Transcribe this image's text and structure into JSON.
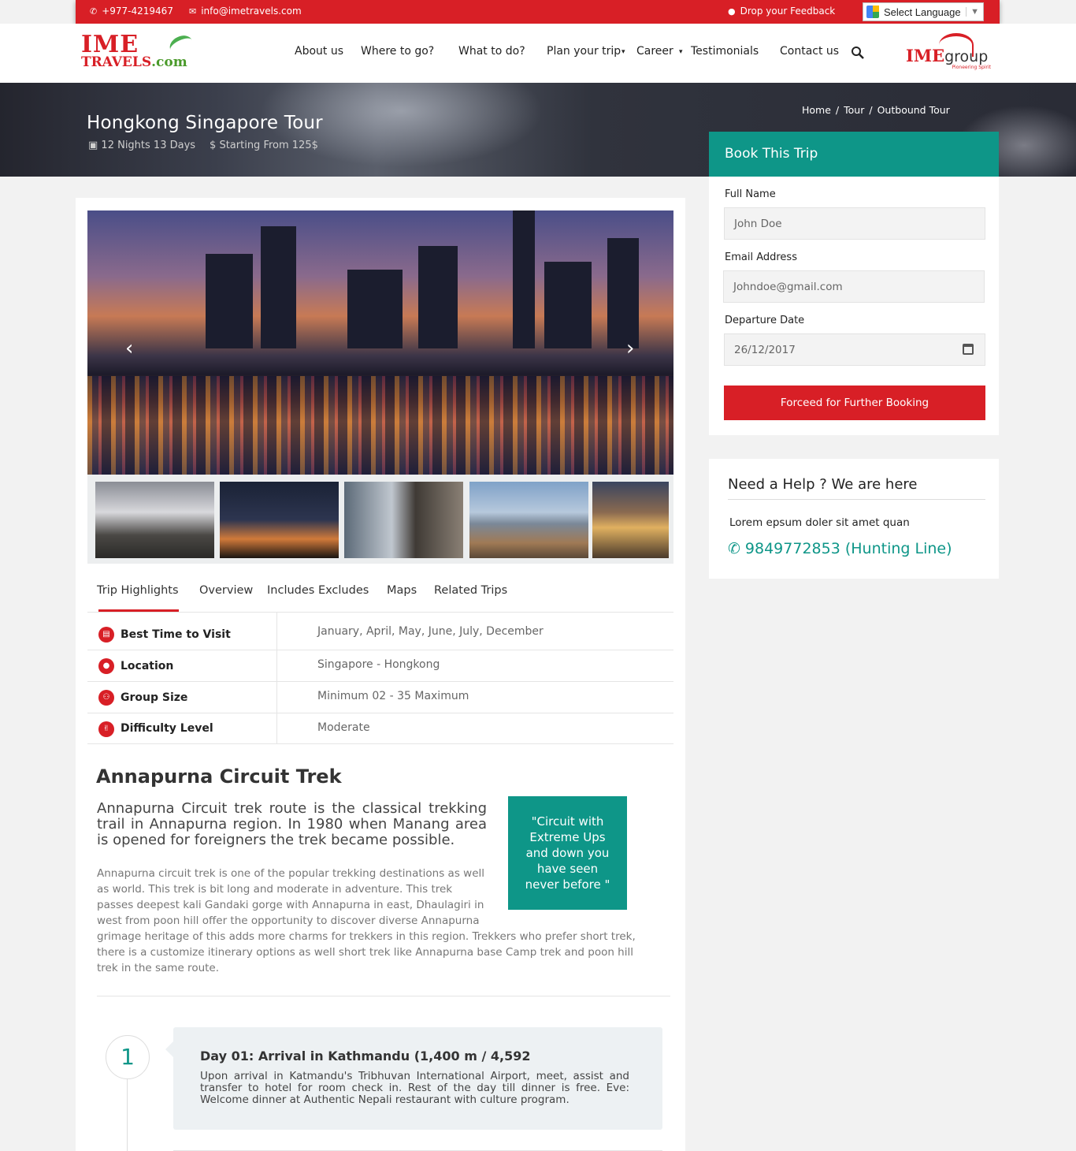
{
  "topbar": {
    "phone": "+977-4219467",
    "email": "info@imetravels.com",
    "feedback": "Drop your Feedback",
    "language": "Select Language"
  },
  "nav": {
    "logo_line1": "IME",
    "logo_line2a": "TRAVELS",
    "logo_line2b": ".com",
    "items": [
      "About us",
      "Where to go?",
      "What to do?",
      "Plan your trip",
      "Career",
      "Testimonials",
      "Contact us"
    ],
    "group_logo_a": "IME",
    "group_logo_b": "group",
    "group_tagline": "Pioneering Spirit"
  },
  "banner": {
    "title": "Hongkong Singapore Tour",
    "duration": "12 Nights 13 Days",
    "price": "$ Starting From 125$",
    "breadcrumb": [
      "Home",
      "/",
      "Tour",
      "/",
      "Outbound Tour"
    ]
  },
  "tabs": [
    "Trip Highlights",
    "Overview",
    "Includes Excludes",
    "Maps",
    "Related Trips"
  ],
  "highlights": [
    {
      "label": "Best Time to Visit",
      "value": "January, April, May, June, July, December",
      "icon": "calendar-icon"
    },
    {
      "label": "Location",
      "value": "Singapore - Hongkong",
      "icon": "location-pin-icon"
    },
    {
      "label": "Group Size",
      "value": "Minimum 02 - 35 Maximum",
      "icon": "group-icon"
    },
    {
      "label": "Difficulty Level",
      "value": "Moderate",
      "icon": "thumbs-up-icon"
    }
  ],
  "article": {
    "title": "Annapurna Circuit Trek",
    "lead": "Annapurna Circuit trek route is the classical trekking trail in Annapurna region. In 1980 when Manang area is opened for foreigners the trek became possible.",
    "body_clipped": "Annapurna circuit trek is one of the popular trekking destinations as well as world. This trek is bit long and moderate in adventure. This trek passes deepest kali Gandaki gorge with Annapurna in east, Dhaulagiri in west from poon hill offer the opportunity to discover diverse Annapurna region",
    "body_rest": "grimage heritage of this adds more charms for trekkers in this region. Trekkers who prefer short trek, there is a customize itinerary options as well short trek like Annapurna base Camp trek and poon hill trek in the same route.",
    "quote": "\"Circuit with Extreme Ups and down you have seen never before \""
  },
  "itinerary": [
    {
      "num": "1",
      "title": "Day 01: Arrival in Kathmandu (1,400 m / 4,592",
      "desc": "Upon arrival in Katmandu's Tribhuvan International Airport, meet, assist and transfer to hotel for room check in. Rest of the day till dinner is free.  Eve: Welcome dinner at Authentic Nepali restaurant with culture program."
    }
  ],
  "booking": {
    "heading": "Book This Trip",
    "name_label": "Full Name",
    "name_placeholder": "John Doe",
    "email_label": "Email Address",
    "email_placeholder": "Johndoe@gmail.com",
    "date_label": "Departure Date",
    "date_value": "26/12/2017",
    "submit": "Forceed for Further Booking"
  },
  "help": {
    "title": "Need a Help ? We are here",
    "text": "Lorem epsum doler sit amet quan",
    "phone": "9849772853 (Hunting Line)"
  },
  "colors": {
    "brand_red": "#d81f26",
    "teal": "#0e9688"
  }
}
